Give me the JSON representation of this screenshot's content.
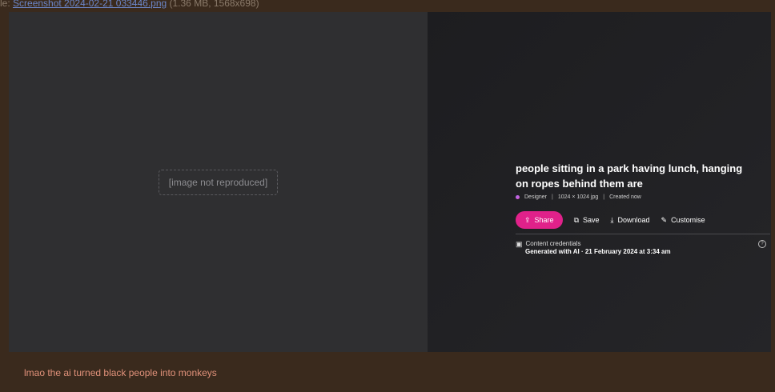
{
  "file": {
    "prefix": "le: ",
    "name": "Screenshot 2024-02-21 033446.png",
    "info": " (1.36 MB, 1568x698)"
  },
  "image_pane": {
    "placeholder": "[image not reproduced]"
  },
  "details": {
    "prompt": "people sitting in a park having lunch, hanging on ropes behind them are",
    "meta": {
      "app": "Designer",
      "separator": "|",
      "size": "1024 × 1024 jpg",
      "created": "Created now"
    },
    "actions": {
      "share": "Share",
      "save": "Save",
      "download": "Download",
      "customise": "Customise"
    },
    "credentials": {
      "title": "Content credentials",
      "generated": "Generated with AI · 21 February 2024 at 3:34 am"
    }
  },
  "comment": "lmao the ai turned black people into monkeys"
}
